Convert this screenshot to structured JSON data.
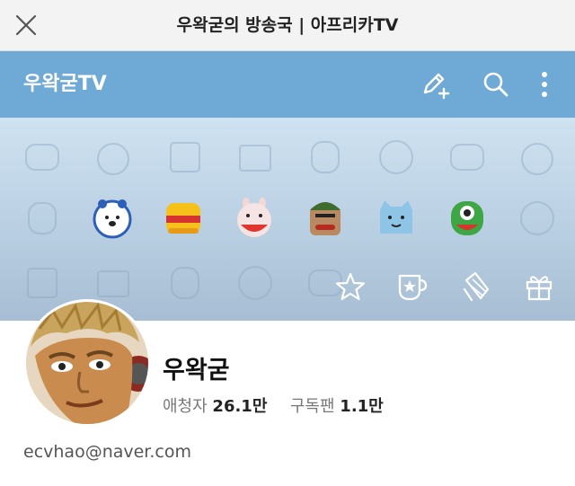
{
  "page": {
    "title": "우왁굳의 방송국 | 아프리카TV"
  },
  "header": {
    "channel_name": "우왁굳TV"
  },
  "banner": {
    "actions": [
      "star-icon",
      "mug-icon",
      "ribbon-icon",
      "gift-icon"
    ]
  },
  "profile": {
    "nickname": "우왁굳",
    "fans_label": "애청자",
    "fans_value": "26.1만",
    "subs_label": "구독팬",
    "subs_value": "1.1만",
    "email": "ecvhao@naver.com"
  },
  "colors": {
    "topbar": "#f3f3f3",
    "appbar": "#6fa9d5",
    "banner_top": "#cfe2f1",
    "banner_bottom": "#a7bdd3"
  }
}
